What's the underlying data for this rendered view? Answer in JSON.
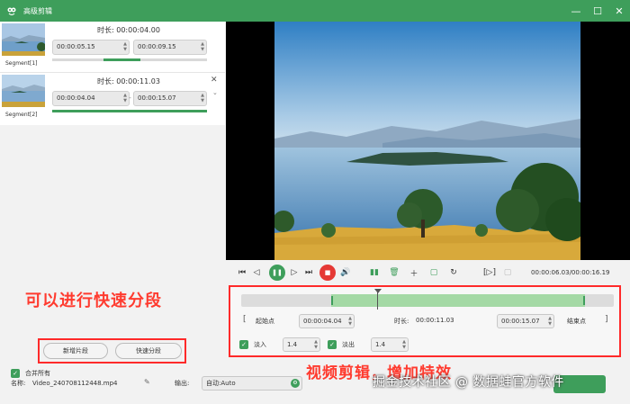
{
  "window": {
    "title": "高级剪辑",
    "minimize_icon": "minimize-icon",
    "maximize_icon": "maximize-icon",
    "close_icon": "close-icon"
  },
  "segments": [
    {
      "label": "Segment[1]",
      "duration_label": "时长:",
      "duration": "00:00:04.00",
      "start": "00:00:05.15",
      "end": "00:00:09.15",
      "progress_start": 0.33,
      "progress_end": 0.57
    },
    {
      "label": "Segment[2]",
      "duration_label": "时长:",
      "duration": "00:00:11.03",
      "start": "00:00:04.04",
      "end": "00:00:15.07",
      "separator": "-",
      "progress_start": 0.0,
      "progress_end": 1.0
    }
  ],
  "annotations": {
    "left_caption": "可以进行快速分段",
    "right_caption": "视频剪辑，增加特效",
    "watermark": "掘金技术社区 @ 数据蛙官方软件"
  },
  "left_buttons": {
    "new_segment": "新增片段",
    "quick_split": "快速分段"
  },
  "merge": {
    "label": "合并所有",
    "checked": true
  },
  "player": {
    "time_readout": "00:00:06.03/00:00:16.19"
  },
  "range": {
    "start_label": "起始点",
    "start_value": "00:00:04.04",
    "duration_label": "时长:",
    "duration_value": "00:00:11.03",
    "end_value": "00:00:15.07",
    "end_label": "结束点"
  },
  "fade": {
    "fade_in_label": "淡入",
    "fade_in_value": "1.4",
    "fade_out_label": "淡出",
    "fade_out_value": "1.4"
  },
  "bottom": {
    "name_label": "名称:",
    "name_value": "Video_240708112448.mp4",
    "output_label": "输出:",
    "output_value": "自动:Auto"
  },
  "colors": {
    "accent": "#3e9e5b",
    "highlight_box": "#ff2a2a",
    "caption": "#ff3b2f",
    "stop": "#e53935"
  }
}
